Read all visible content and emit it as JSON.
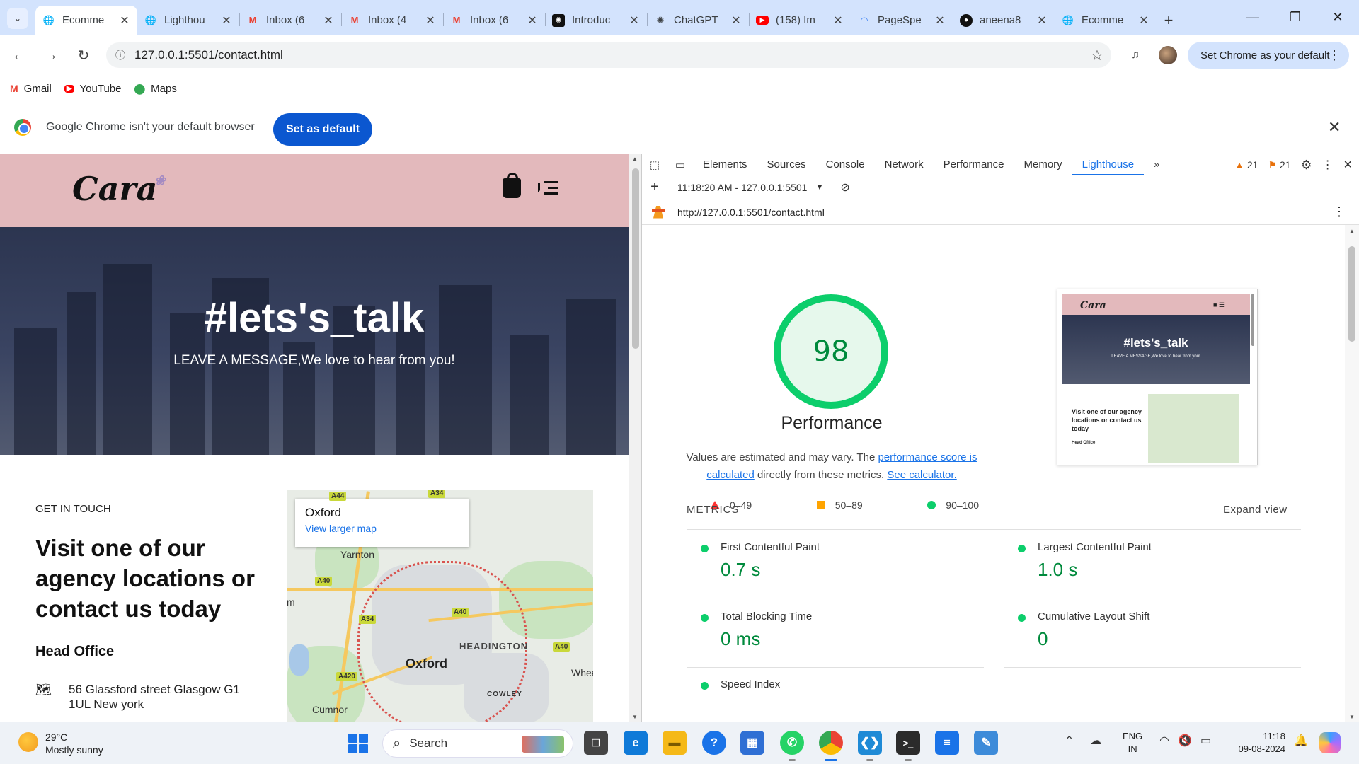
{
  "browser": {
    "tabs": [
      {
        "title": "Ecomme",
        "icon": "globe-icon",
        "active": true
      },
      {
        "title": "Lighthou",
        "icon": "globe-icon"
      },
      {
        "title": "Inbox (6",
        "icon": "gmail-icon"
      },
      {
        "title": "Inbox (4",
        "icon": "gmail-icon"
      },
      {
        "title": "Inbox (6",
        "icon": "gmail-icon"
      },
      {
        "title": "Introduc",
        "icon": "openai-icon"
      },
      {
        "title": "ChatGPT",
        "icon": "openai-icon"
      },
      {
        "title": "(158) Im",
        "icon": "youtube-icon"
      },
      {
        "title": "PageSpe",
        "icon": "pagespeed-icon"
      },
      {
        "title": "aneena8",
        "icon": "github-icon"
      },
      {
        "title": "Ecomme",
        "icon": "globe-icon"
      }
    ],
    "url": "127.0.0.1:5501/contact.html",
    "default_pill": "Set Chrome as your default",
    "bookmarks": [
      {
        "label": "Gmail",
        "icon": "gmail-icon"
      },
      {
        "label": "YouTube",
        "icon": "youtube-icon"
      },
      {
        "label": "Maps",
        "icon": "maps-pin-icon"
      }
    ],
    "infobar": {
      "message": "Google Chrome isn't your default browser",
      "button": "Set as default"
    }
  },
  "site": {
    "hero_title": "#lets's_talk",
    "hero_subtitle": "LEAVE A MESSAGE,We love to hear from you!",
    "get_in_touch": "GET IN TOUCH",
    "heading": "Visit one of our agency locations or contact us today",
    "head_office": "Head Office",
    "address": "56 Glassford street Glasgow G1 1UL New york",
    "map": {
      "place": "Oxford",
      "link": "View larger map",
      "labels": {
        "yarnton": "Yarnton",
        "headington": "HEADINGTON",
        "oxford": "Oxford",
        "cowley": "COWLEY",
        "cumnor": "Cumnor",
        "whea": "Whea",
        "m": "m"
      },
      "roads": {
        "a44a": "A44",
        "a34a": "A34",
        "a40a": "A40",
        "a34b": "A34",
        "a40b": "A40",
        "a40c": "A40",
        "a420": "A420"
      }
    }
  },
  "devtools": {
    "tabs": [
      "Elements",
      "Sources",
      "Console",
      "Network",
      "Performance",
      "Memory",
      "Lighthouse"
    ],
    "active_tab": "Lighthouse",
    "warnings": "21",
    "issues": "21",
    "run": "11:18:20 AM - 127.0.0.1:5501",
    "report_url": "http://127.0.0.1:5501/contact.html",
    "score": "98",
    "score_fraction": 0.98,
    "category": "Performance",
    "desc_prefix": "Values are estimated and may vary. The ",
    "desc_link1": "performance score is calculated",
    "desc_mid": " directly from these metrics. ",
    "desc_link2": "See calculator.",
    "legend": {
      "fail": "0–49",
      "average": "50–89",
      "pass": "90–100"
    },
    "colors": {
      "pass": "#0cce6b",
      "average": "#ffa400",
      "fail": "#ff3333"
    },
    "metrics_header": "METRICS",
    "expand": "Expand view",
    "metrics": [
      {
        "name": "First Contentful Paint",
        "value": "0.7 s"
      },
      {
        "name": "Largest Contentful Paint",
        "value": "1.0 s"
      },
      {
        "name": "Total Blocking Time",
        "value": "0 ms"
      },
      {
        "name": "Cumulative Layout Shift",
        "value": "0"
      },
      {
        "name": "Speed Index",
        "value": ""
      }
    ],
    "thumbnail": {
      "title": "#lets's_talk",
      "subtitle": "LEAVE A MESSAGE,We love to hear from you!",
      "heading": "Visit one of our agency locations or contact us today",
      "head_office": "Head Office"
    }
  },
  "taskbar": {
    "temp": "29°C",
    "weather": "Mostly sunny",
    "search": "Search",
    "lang1": "ENG",
    "lang2": "IN",
    "time": "11:18",
    "date": "09-08-2024"
  }
}
